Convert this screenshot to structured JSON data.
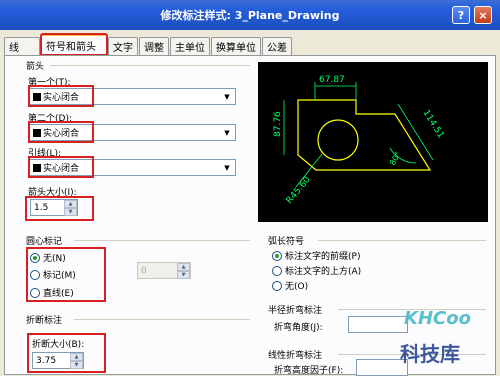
{
  "window": {
    "title": "修改标注样式: 3_Plane_Drawing",
    "help": "?",
    "close": "×"
  },
  "tabs": [
    "线",
    "符号和箭头",
    "文字",
    "调整",
    "主单位",
    "换算单位",
    "公差"
  ],
  "arrowheads": {
    "group_label": "箭头",
    "first_label": "第一个(T):",
    "first_value": "实心闭合",
    "second_label": "第二个(D):",
    "second_value": "实心闭合",
    "leader_label": "引线(L):",
    "leader_value": "实心闭合",
    "size_label": "箭头大小(I):",
    "size_value": "1.5"
  },
  "center_marks": {
    "group_label": "圆心标记",
    "options": [
      "无(N)",
      "标记(M)",
      "直线(E)"
    ],
    "selected": 0,
    "size_value": "0"
  },
  "dim_break": {
    "group_label": "折断标注",
    "size_label": "折断大小(B):",
    "size_value": "3.75"
  },
  "arc_length": {
    "group_label": "弧长符号",
    "options": [
      "标注文字的前缀(P)",
      "标注文字的上方(A)",
      "无(O)"
    ],
    "selected": 0
  },
  "radius_jog": {
    "group_label": "半径折弯标注",
    "angle_label": "折弯角度(J):"
  },
  "linear_jog": {
    "group_label": "线性折弯标注",
    "height_label": "折弯高度因子(F):"
  },
  "preview": {
    "dim_top": "67.87",
    "dim_left": "87.76",
    "dim_diag": "114.51",
    "dim_angle": "80°",
    "dim_radius": "R45.60",
    "colors": {
      "geometry": "#ffff00",
      "dimension": "#00ff66",
      "background": "#000000"
    }
  },
  "watermark": {
    "logo": "KHCoo",
    "text": "科技库"
  }
}
